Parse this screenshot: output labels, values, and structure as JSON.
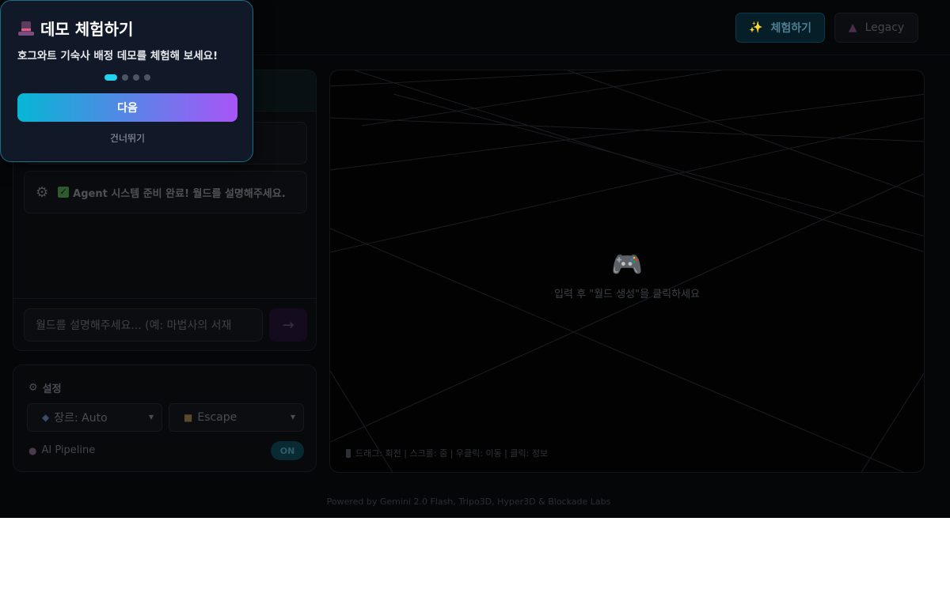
{
  "header": {
    "try_button": {
      "icon": "sparkles-icon",
      "label": "체험하기"
    },
    "legacy_button": {
      "icon": "wizard-hat-icon",
      "label": "Legacy"
    }
  },
  "chat": {
    "messages": [
      {
        "text": ""
      },
      {
        "icon": "gear-icon",
        "check_icon": "check-icon",
        "text": "Agent 시스템 준비 완료! 월드를 설명해주세요."
      }
    ],
    "input_placeholder": "월드를 설명해주세요... (예: 마법사의 서재",
    "send_label": "→"
  },
  "settings": {
    "title": "설정",
    "genre_select": {
      "icon": "masks-icon",
      "value": "장르: Auto"
    },
    "mode_select": {
      "icon": "lock-icon",
      "value": "Escape"
    },
    "pipeline_label": "AI Pipeline",
    "pipeline_toggle": "ON"
  },
  "viewport": {
    "empty_icon": "gamepad-icon",
    "empty_text": "입력 후 \"월드 생성\"을 클릭하세요",
    "hint": "드래그: 회전 | 스크롤: 줌 | 우클릭: 이동 | 클릭: 정보"
  },
  "footer": "Powered by Gemini 2.0 Flash, Tripo3D, Hyper3D & Blockade Labs",
  "onboarding": {
    "title": "데모 체험하기",
    "description": "호그와트 기숙사 배정 데모를 체험해 보세요!",
    "step": 1,
    "total_steps": 4,
    "next_label": "다음",
    "skip_label": "건너뛰기"
  },
  "colors": {
    "accent_cyan": "#06b6d4",
    "accent_purple": "#a855f7",
    "popup_bg": "#111827"
  }
}
